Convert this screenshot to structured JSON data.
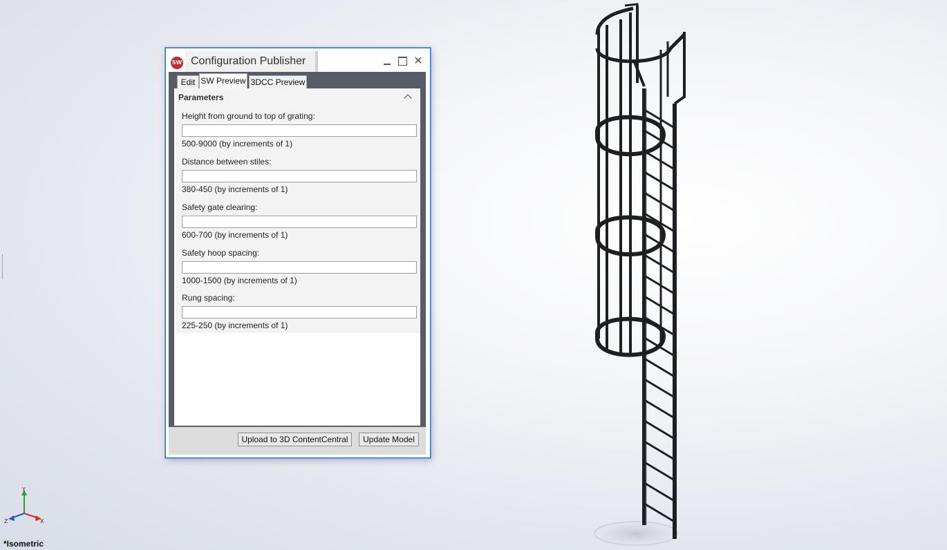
{
  "dialog": {
    "title": "Configuration Publisher",
    "app_icon_text": "SW",
    "window_controls": {
      "close": "✕"
    },
    "tabs": [
      {
        "label": "Edit",
        "active": false
      },
      {
        "label": "SW Preview",
        "active": true
      },
      {
        "label": "3DCC Preview",
        "active": false
      }
    ],
    "parameters": {
      "header": "Parameters",
      "fields": [
        {
          "label": "Height from ground to top of grating:",
          "value": "",
          "hint": "500-9000 (by increments of 1)"
        },
        {
          "label": "Distance between stiles:",
          "value": "",
          "hint": "380-450 (by increments of 1)"
        },
        {
          "label": "Safety gate clearing:",
          "value": "",
          "hint": "600-700 (by increments of 1)"
        },
        {
          "label": "Safety hoop spacing:",
          "value": "",
          "hint": "1000-1500 (by increments of 1)"
        },
        {
          "label": "Rung spacing:",
          "value": "",
          "hint": "225-250 (by increments of 1)"
        }
      ]
    },
    "buttons": {
      "upload": "Upload to 3D ContentCentral",
      "update": "Update Model"
    }
  },
  "viewport": {
    "view_label": "*Isometric",
    "triad": {
      "x_label": "X",
      "y_label": "Y",
      "z_label": "Z"
    }
  },
  "colors": {
    "accent_border": "#2f74c8",
    "dialog_frame": "#585c68",
    "triad_x": "#d0302a",
    "triad_y": "#2a9a3a",
    "triad_z": "#2a55c8"
  }
}
